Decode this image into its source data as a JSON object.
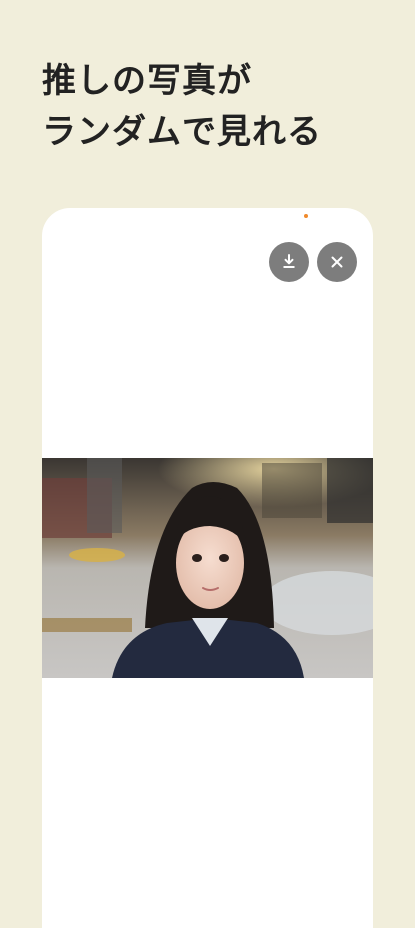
{
  "headline": {
    "line1": "推しの写真が",
    "line2": "ランダムで見れる"
  },
  "icons": {
    "download": "download-icon",
    "close": "close-icon"
  },
  "colors": {
    "background": "#f1eedb",
    "card": "#ffffff",
    "button": "#7d7d7d",
    "indicator": "#f08a2c"
  }
}
